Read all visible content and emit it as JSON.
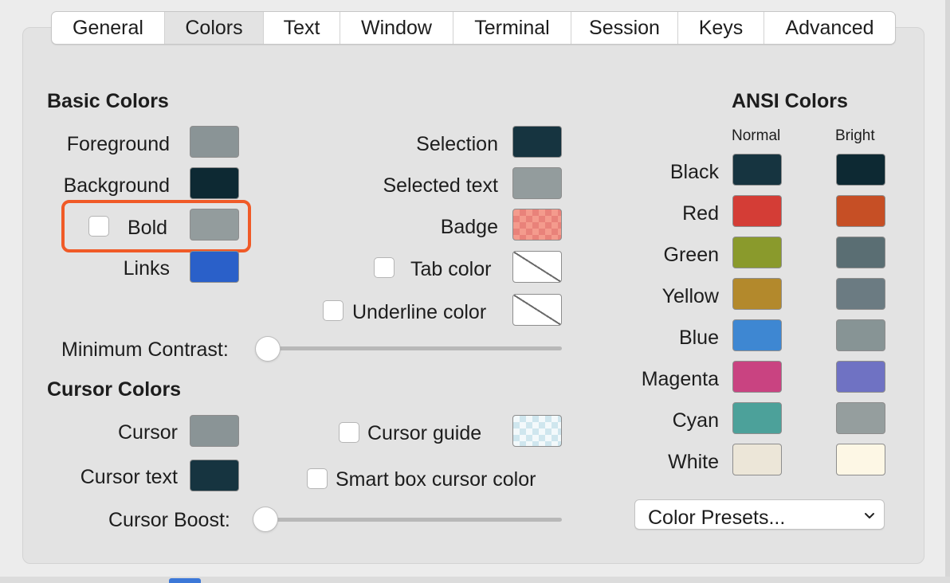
{
  "tabs": [
    {
      "label": "General",
      "selected": false
    },
    {
      "label": "Colors",
      "selected": true
    },
    {
      "label": "Text",
      "selected": false
    },
    {
      "label": "Window",
      "selected": false
    },
    {
      "label": "Terminal",
      "selected": false
    },
    {
      "label": "Session",
      "selected": false
    },
    {
      "label": "Keys",
      "selected": false
    },
    {
      "label": "Advanced",
      "selected": false
    }
  ],
  "basic": {
    "heading": "Basic Colors",
    "foreground": {
      "label": "Foreground",
      "color": "#8a9496"
    },
    "background": {
      "label": "Background",
      "color": "#0d2933"
    },
    "bold": {
      "label": "Bold",
      "checked": false,
      "color": "#939c9d"
    },
    "links": {
      "label": "Links",
      "color": "#2a60c9"
    },
    "selection": {
      "label": "Selection",
      "color": "#163440"
    },
    "selected_text": {
      "label": "Selected text",
      "color": "#939c9d"
    },
    "badge": {
      "label": "Badge"
    },
    "tab_color": {
      "label": "Tab color",
      "checked": false
    },
    "underline_color": {
      "label": "Underline color",
      "checked": false
    },
    "min_contrast": {
      "label": "Minimum Contrast:",
      "value": 0
    }
  },
  "cursor": {
    "heading": "Cursor Colors",
    "cursor": {
      "label": "Cursor",
      "color": "#8a9496"
    },
    "cursor_text": {
      "label": "Cursor text",
      "color": "#163440"
    },
    "cursor_guide": {
      "label": "Cursor guide",
      "checked": false
    },
    "smart_box": {
      "label": "Smart box cursor color",
      "checked": false
    },
    "boost": {
      "label": "Cursor Boost:",
      "value": 0
    }
  },
  "ansi": {
    "heading": "ANSI Colors",
    "normal_label": "Normal",
    "bright_label": "Bright",
    "rows": [
      {
        "name": "Black",
        "normal": "#163440",
        "bright": "#0d2933"
      },
      {
        "name": "Red",
        "normal": "#d43d36",
        "bright": "#c64f25"
      },
      {
        "name": "Green",
        "normal": "#8a9a2c",
        "bright": "#5a6e73"
      },
      {
        "name": "Yellow",
        "normal": "#b3892c",
        "bright": "#6b7b82"
      },
      {
        "name": "Blue",
        "normal": "#3e87d2",
        "bright": "#879495"
      },
      {
        "name": "Magenta",
        "normal": "#c94381",
        "bright": "#6f72c3"
      },
      {
        "name": "Cyan",
        "normal": "#4ca19a",
        "bright": "#959e9e"
      },
      {
        "name": "White",
        "normal": "#ece6d8",
        "bright": "#fdf7e5"
      }
    ]
  },
  "presets": {
    "label": "Color Presets..."
  },
  "colors": {
    "highlight": "#f05a27"
  }
}
